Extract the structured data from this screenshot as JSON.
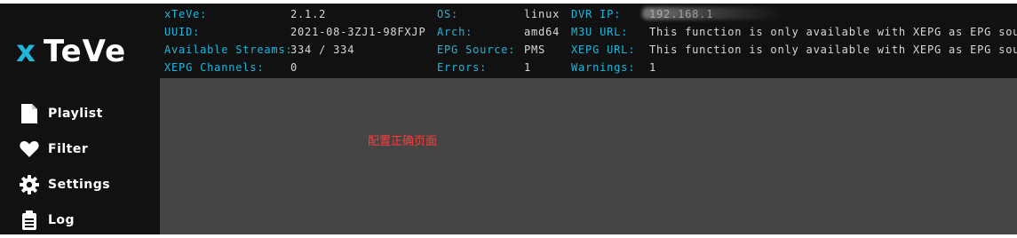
{
  "app": {
    "logo_x": "x",
    "logo_name": "TeVe"
  },
  "sidebar": {
    "items": [
      {
        "label": "Playlist",
        "icon": "file-icon"
      },
      {
        "label": "Filter",
        "icon": "heart-icon"
      },
      {
        "label": "Settings",
        "icon": "gear-icon"
      },
      {
        "label": "Log",
        "icon": "log-icon"
      }
    ]
  },
  "status": {
    "col1": [
      {
        "key": "xTeVe:",
        "value": "2.1.2"
      },
      {
        "key": "UUID:",
        "value": "2021-08-3ZJ1-98FXJP"
      },
      {
        "key": "Available Streams:",
        "value": "334 / 334"
      },
      {
        "key": "XEPG Channels:",
        "value": "0"
      }
    ],
    "col2": [
      {
        "key": "OS:",
        "value": "linux"
      },
      {
        "key": "Arch:",
        "value": "amd64"
      },
      {
        "key": "EPG Source:",
        "value": "PMS"
      },
      {
        "key": "Errors:",
        "value": "1"
      }
    ],
    "col3": [
      {
        "key": "DVR IP:",
        "value": "192.168.1"
      },
      {
        "key": "M3U URL:",
        "value": "This function is only available with XEPG as EPG source"
      },
      {
        "key": "XEPG URL:",
        "value": "This function is only available with XEPG as EPG source"
      },
      {
        "key": "Warnings:",
        "value": "1"
      }
    ]
  },
  "main": {
    "note": "配置正确页面"
  },
  "colors": {
    "accent": "#1fb7dc",
    "sidebar_bg": "#111111",
    "main_bg": "#444444",
    "note": "#ff3b3b"
  }
}
